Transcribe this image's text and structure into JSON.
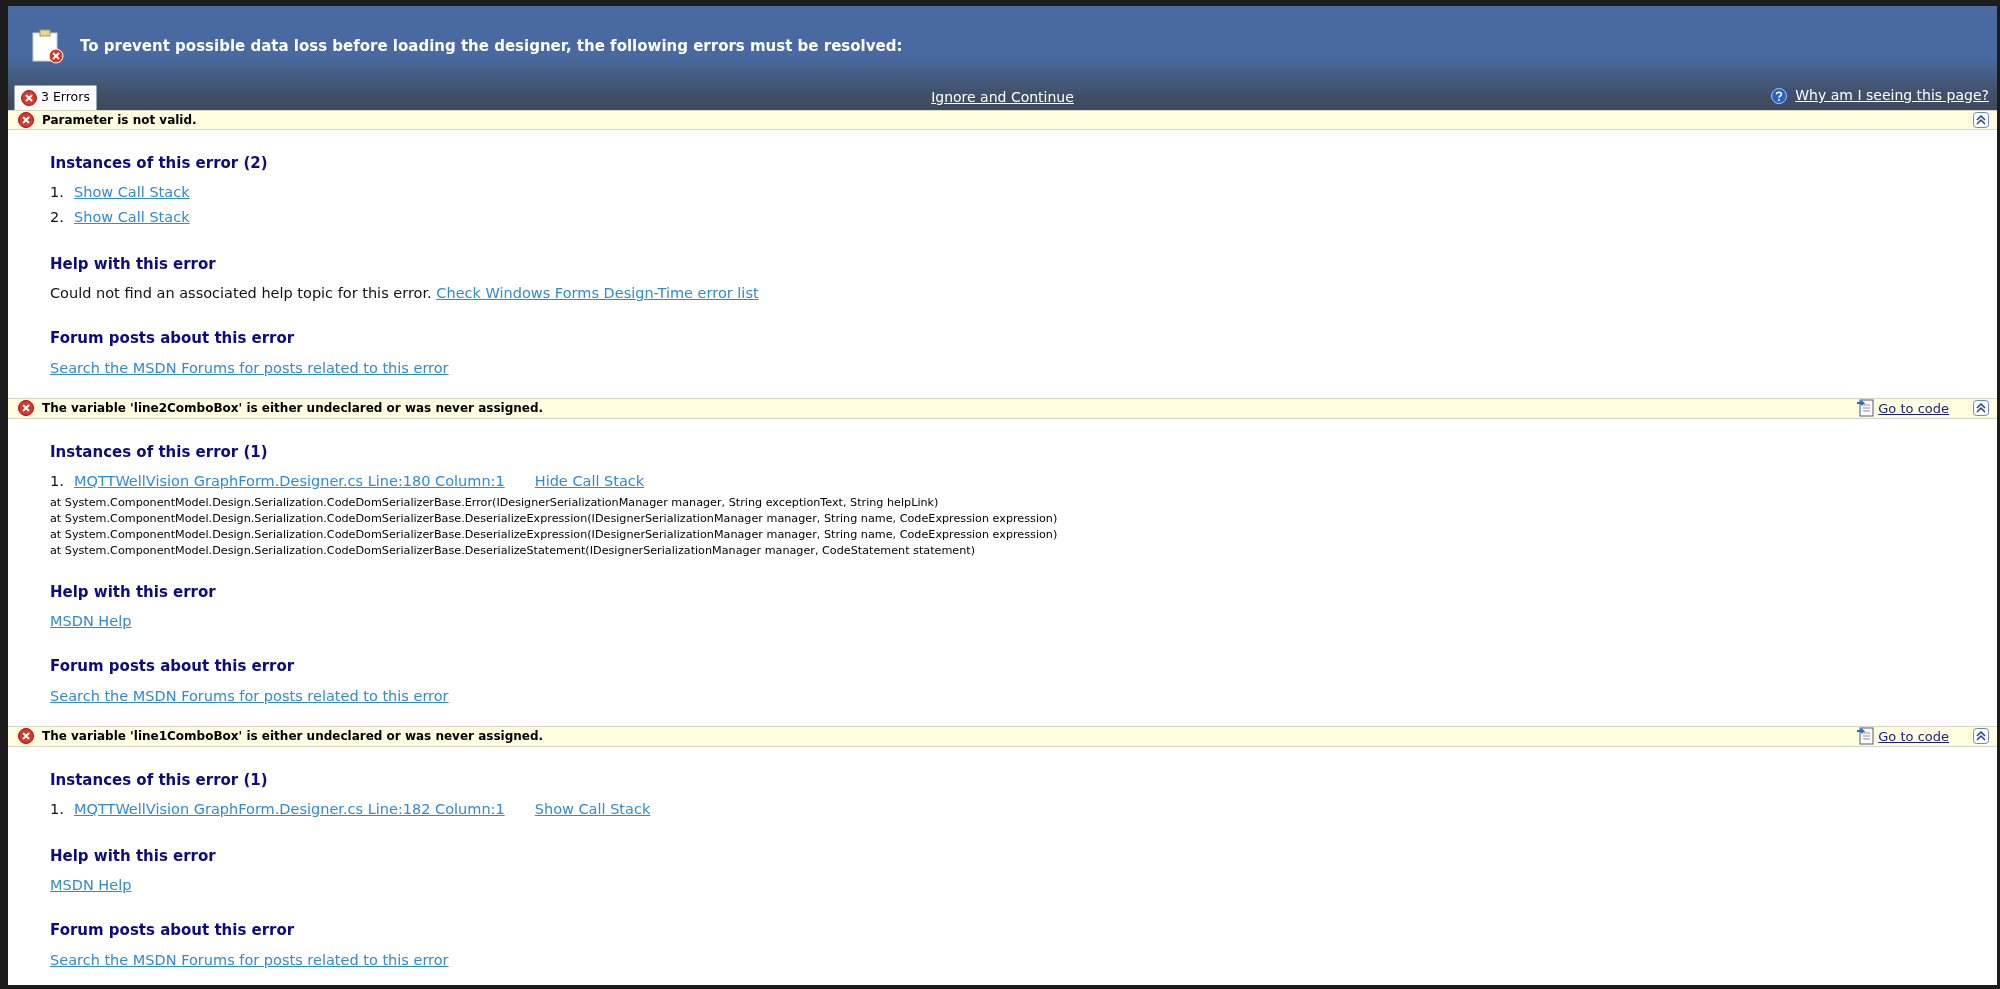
{
  "header": {
    "title": "To prevent possible data loss before loading the designer, the following errors must be resolved:",
    "tab": {
      "label": "3 Errors",
      "selected": true
    },
    "ignore_link": "Ignore and Continue",
    "help_link": "Why am I seeing this page?"
  },
  "errors": [
    {
      "message": "Parameter is not valid.",
      "expanded": true,
      "instances_heading": "Instances of this error (2)",
      "instances": [
        {
          "number": "1.",
          "stack_toggle": "Show Call Stack"
        },
        {
          "number": "2.",
          "stack_toggle": "Show Call Stack"
        }
      ],
      "help_heading": "Help with this error",
      "help_text": "Could not find an associated help topic for this error.",
      "help_link": "Check Windows Forms Design-Time error list",
      "forum_heading": "Forum posts about this error",
      "forum_link": "Search the MSDN Forums for posts related to this error"
    },
    {
      "message": "The variable 'line2ComboBox' is either undeclared or was never assigned.",
      "go_to_code": "Go to code",
      "expanded": true,
      "instances_heading": "Instances of this error (1)",
      "instances": [
        {
          "number": "1.",
          "location": "MQTTWellVision GraphForm.Designer.cs Line:180 Column:1",
          "stack_toggle": "Hide Call Stack",
          "stack_lines": [
            "at System.ComponentModel.Design.Serialization.CodeDomSerializerBase.Error(IDesignerSerializationManager manager, String exceptionText, String helpLink)",
            "at System.ComponentModel.Design.Serialization.CodeDomSerializerBase.DeserializeExpression(IDesignerSerializationManager manager, String name, CodeExpression expression)",
            "at System.ComponentModel.Design.Serialization.CodeDomSerializerBase.DeserializeExpression(IDesignerSerializationManager manager, String name, CodeExpression expression)",
            "at System.ComponentModel.Design.Serialization.CodeDomSerializerBase.DeserializeStatement(IDesignerSerializationManager manager, CodeStatement statement)"
          ]
        }
      ],
      "help_heading": "Help with this error",
      "help_link": "MSDN Help",
      "forum_heading": "Forum posts about this error",
      "forum_link": "Search the MSDN Forums for posts related to this error"
    },
    {
      "message": "The variable 'line1ComboBox' is either undeclared or was never assigned.",
      "go_to_code": "Go to code",
      "expanded": true,
      "instances_heading": "Instances of this error (1)",
      "instances": [
        {
          "number": "1.",
          "location": "MQTTWellVision GraphForm.Designer.cs Line:182 Column:1",
          "stack_toggle": "Show Call Stack"
        }
      ],
      "help_heading": "Help with this error",
      "help_link": "MSDN Help",
      "forum_heading": "Forum posts about this error",
      "forum_link": "Search the MSDN Forums for posts related to this error"
    }
  ]
}
